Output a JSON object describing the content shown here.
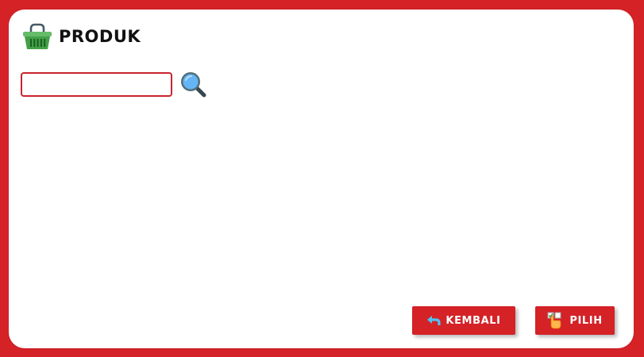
{
  "header": {
    "title": "PRODUK",
    "icon": "basket-icon"
  },
  "search": {
    "value": "",
    "placeholder": "",
    "button_icon": "magnifier-icon"
  },
  "buttons": {
    "back_label": "KEMBALI",
    "back_icon": "return-arrow-icon",
    "select_label": "PILIH",
    "select_icon": "hand-pointer-icon"
  },
  "colors": {
    "background": "#d42227",
    "panel": "#ffffff",
    "button": "#d42227",
    "input_border": "#c8242b",
    "basket_green": "#4caf50",
    "magnifier_lens": "#64b5f6",
    "back_arrow": "#4fc3f7"
  }
}
